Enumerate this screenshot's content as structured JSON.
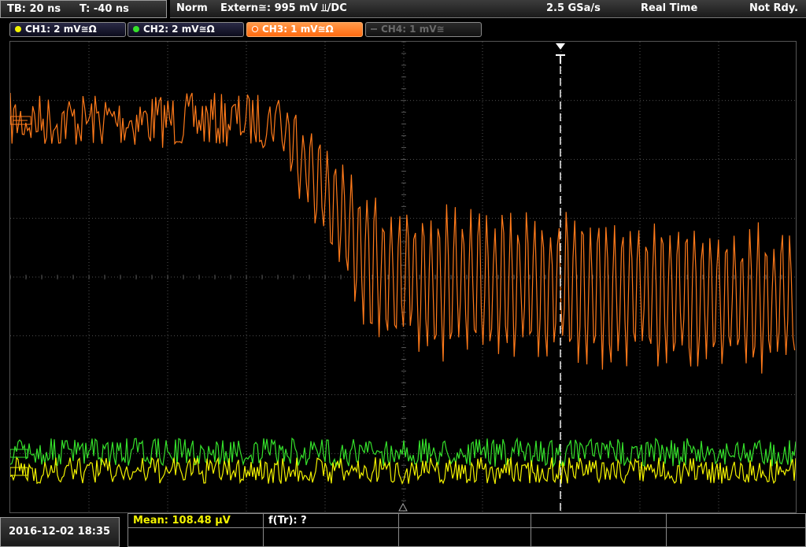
{
  "header": {
    "timebase": "TB: 20 ns",
    "trigger_offset": "T: -40 ns",
    "trigger_mode": "Norm",
    "trigger_source": "Extern≅: 995 mV ⫫/DC",
    "sample_rate": "2.5 GSa/s",
    "acq_mode": "Real Time",
    "run_state": "Not Rdy."
  },
  "channels": [
    {
      "label": "CH1: 2 mV≅Ω",
      "color": "#f3f300",
      "active": true
    },
    {
      "label": "CH2: 2 mV≅Ω",
      "color": "#35e12b",
      "active": true
    },
    {
      "label": "CH3: 1 mV≅Ω",
      "color": "#ff7a1a",
      "active": true,
      "selected": true
    },
    {
      "label": "CH4: 1 mV≅",
      "color": "#6a6a6a",
      "active": false
    }
  ],
  "footer": {
    "datetime": "2016-12-02 18:35",
    "measurement_1": "Mean: 108.48 μV",
    "measurement_2": "f(Tr): ?"
  },
  "colors": {
    "ch1": "#f3f300",
    "ch2": "#35e12b",
    "ch3": "#ff7a1a",
    "grid": "#6a6a6a",
    "trigger": "#ffffff"
  },
  "icons": {
    "trigger_marker": "trigger-t-marker-icon",
    "time_reference": "time-reference-triangle-icon",
    "ch_offset_markers": "channel-offset-marker-icon"
  }
}
